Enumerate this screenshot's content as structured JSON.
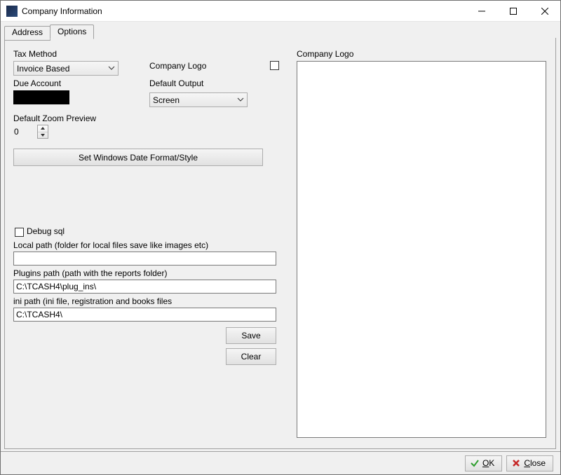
{
  "title": "Company Information",
  "tabs": {
    "address": "Address",
    "options": "Options"
  },
  "labels": {
    "tax_method": "Tax Method",
    "due_account": "Due Account",
    "default_zoom": "Default Zoom Preview",
    "company_logo": "Company Logo",
    "default_output": "Default Output",
    "company_logo_panel": "Company Logo",
    "debug_sql": "Debug sql",
    "local_path": "Local path (folder for local files save like images etc)",
    "plugins_path": "Plugins path (path with the reports folder)",
    "ini_path": "ini path  (ini file, registration and books files"
  },
  "values": {
    "tax_method": "Invoice Based",
    "default_output": "Screen",
    "zoom": "0",
    "local_path": "",
    "plugins_path": "C:\\TCASH4\\plug_ins\\",
    "ini_path": "C:\\TCASH4\\"
  },
  "buttons": {
    "set_date": "Set Windows Date Format/Style",
    "save": "Save",
    "clear": "Clear",
    "ok": "OK",
    "close": "Close"
  }
}
